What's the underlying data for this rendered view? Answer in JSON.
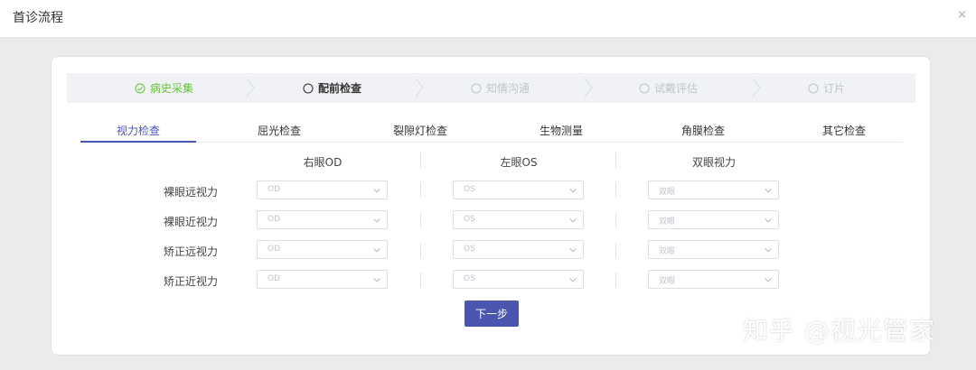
{
  "window": {
    "title": "首诊流程",
    "close_glyph": "×"
  },
  "steps": [
    {
      "label": "病史采集",
      "state": "done",
      "icon": "check-circle-icon"
    },
    {
      "label": "配前检查",
      "state": "active",
      "icon": "circle-icon"
    },
    {
      "label": "知情沟通",
      "state": "pending",
      "icon": "circle-icon"
    },
    {
      "label": "试戴评估",
      "state": "pending",
      "icon": "circle-icon"
    },
    {
      "label": "订片",
      "state": "pending",
      "icon": "circle-icon"
    }
  ],
  "tabs": [
    {
      "label": "视力检查",
      "active": true
    },
    {
      "label": "屈光检查"
    },
    {
      "label": "裂隙灯检查"
    },
    {
      "label": "生物测量"
    },
    {
      "label": "角膜检查"
    },
    {
      "label": "其它检查"
    }
  ],
  "columns": [
    "右眼OD",
    "左眼OS",
    "双眼视力"
  ],
  "rows": [
    {
      "label": "裸眼远视力",
      "placeholders": [
        "OD",
        "OS",
        "双眼"
      ]
    },
    {
      "label": "裸眼近视力",
      "placeholders": [
        "OD",
        "OS",
        "双眼"
      ]
    },
    {
      "label": "矫正远视力",
      "placeholders": [
        "OD",
        "OS",
        "双眼"
      ]
    },
    {
      "label": "矫正近视力",
      "placeholders": [
        "OD",
        "OS",
        "双眼"
      ]
    }
  ],
  "next_button": "下一步",
  "watermark": "知乎 @视光管家",
  "colors": {
    "accent": "#4a56ad",
    "success": "#67c23a",
    "disabled": "#c0c4cc"
  }
}
